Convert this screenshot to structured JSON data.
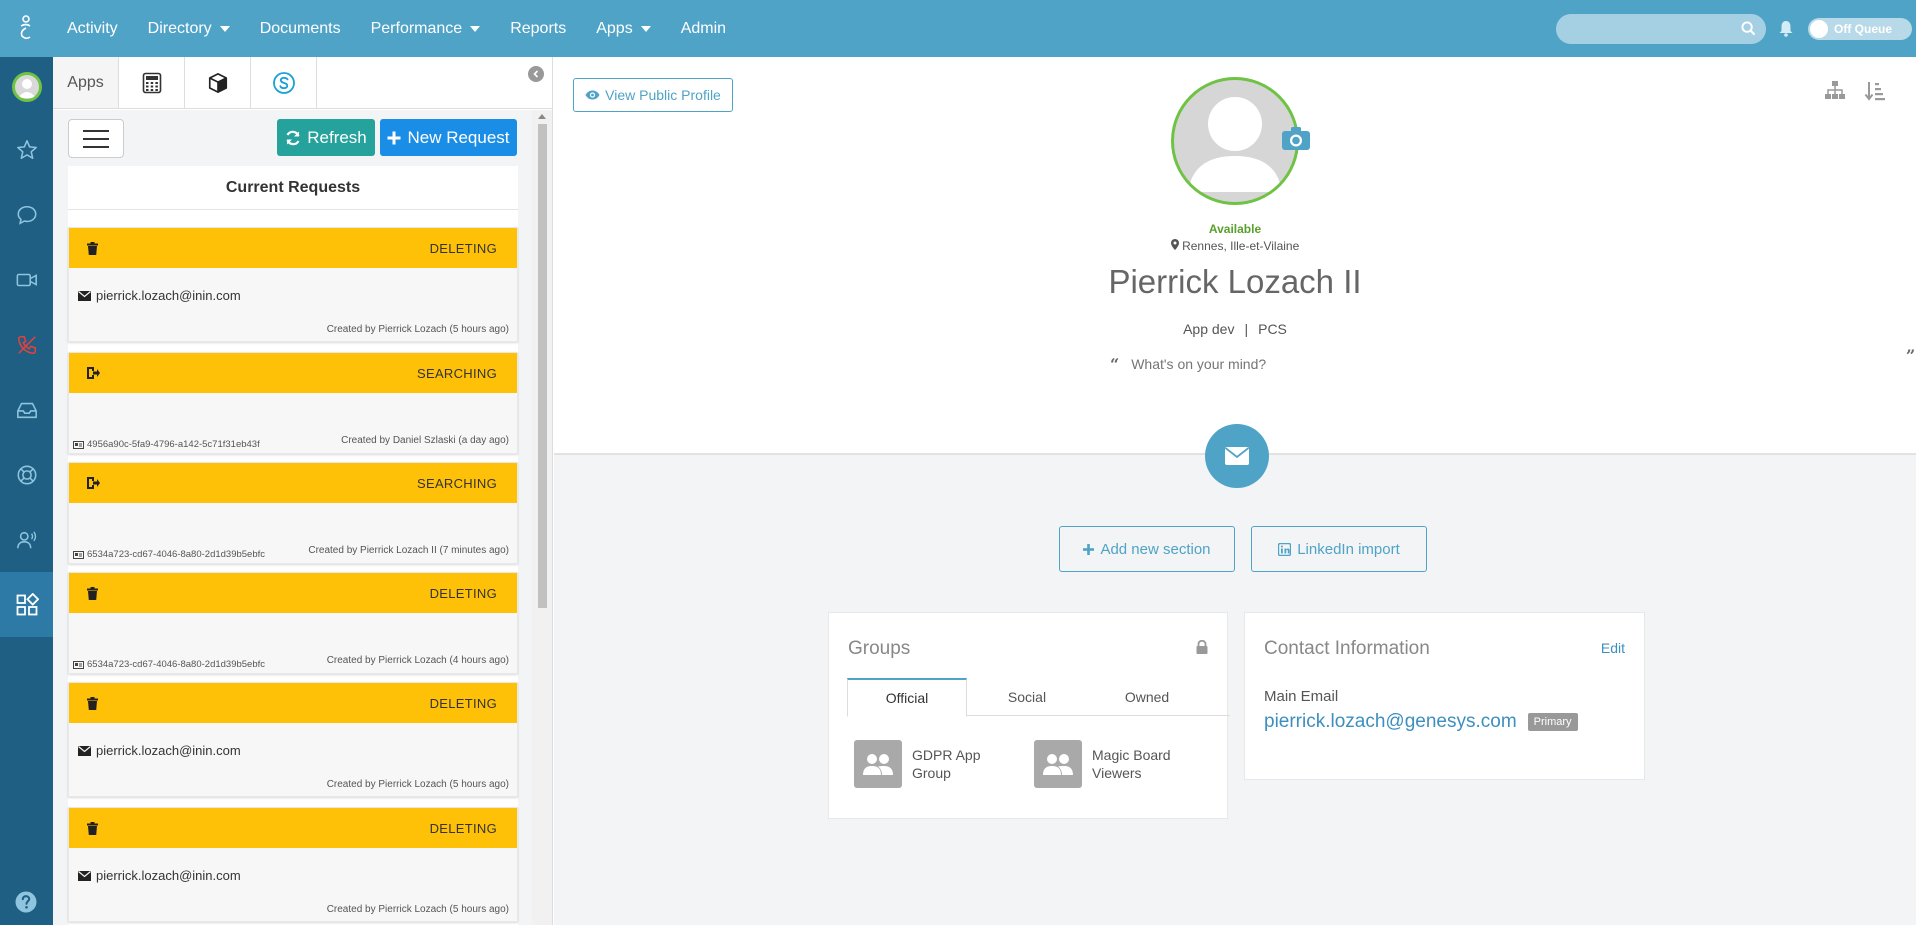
{
  "nav": {
    "items": [
      {
        "label": "Activity",
        "dropdown": false
      },
      {
        "label": "Directory",
        "dropdown": true
      },
      {
        "label": "Documents",
        "dropdown": false
      },
      {
        "label": "Performance",
        "dropdown": true
      },
      {
        "label": "Reports",
        "dropdown": false
      },
      {
        "label": "Apps",
        "dropdown": true
      },
      {
        "label": "Admin",
        "dropdown": false
      }
    ],
    "queue_toggle": "Off Queue"
  },
  "apps_panel": {
    "tab_label": "Apps",
    "refresh_label": "Refresh",
    "new_request_label": "New Request",
    "list_title": "Current Requests",
    "requests": [
      {
        "status": "DELETING",
        "icon": "trash-icon",
        "email": "pierrick.lozach@inin.com",
        "id": "",
        "created": "Created by Pierrick Lozach (5 hours ago)"
      },
      {
        "status": "SEARCHING",
        "icon": "sign-out-icon",
        "email": "",
        "id": "4956a90c-5fa9-4796-a142-5c71f31eb43f",
        "created": "Created by Daniel Szlaski (a day ago)"
      },
      {
        "status": "SEARCHING",
        "icon": "sign-out-icon",
        "email": "",
        "id": "6534a723-cd67-4046-8a80-2d1d39b5ebfc",
        "created": "Created by Pierrick Lozach II (7 minutes ago)"
      },
      {
        "status": "DELETING",
        "icon": "trash-icon",
        "email": "",
        "id": "6534a723-cd67-4046-8a80-2d1d39b5ebfc",
        "created": "Created by Pierrick Lozach (4 hours ago)"
      },
      {
        "status": "DELETING",
        "icon": "trash-icon",
        "email": "pierrick.lozach@inin.com",
        "id": "",
        "created": "Created by Pierrick Lozach (5 hours ago)"
      },
      {
        "status": "DELETING",
        "icon": "trash-icon",
        "email": "pierrick.lozach@inin.com",
        "id": "",
        "created": "Created by Pierrick Lozach (5 hours ago)"
      }
    ]
  },
  "profile": {
    "view_public_label": "View Public Profile",
    "status": "Available",
    "location": "Rennes, Ille-et-Vilaine",
    "name": "Pierrick Lozach II",
    "title": "App dev",
    "department": "PCS",
    "role_separator": "|",
    "mind_placeholder": "What's on your mind?",
    "add_section_label": "Add new section",
    "linkedin_label": "LinkedIn import"
  },
  "groups": {
    "title": "Groups",
    "tabs": [
      "Official",
      "Social",
      "Owned"
    ],
    "active_tab": "Official",
    "items": [
      "GDPR App Group",
      "Magic Board Viewers"
    ]
  },
  "contact": {
    "title": "Contact Information",
    "edit_label": "Edit",
    "email_label": "Main Email",
    "email": "pierrick.lozach@genesys.com",
    "badge": "Primary"
  },
  "colors": {
    "nav": "#4fa3c7",
    "rail": "#1f5f83",
    "status_bar": "#ffc107",
    "refresh": "#25a29b",
    "new_request": "#1a8ee6",
    "available": "#5aa02c"
  }
}
